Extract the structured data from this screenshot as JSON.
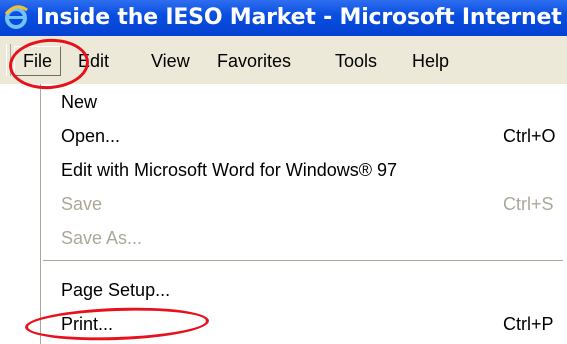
{
  "window": {
    "title": "Inside the IESO Market - Microsoft Internet",
    "app_icon": "internet-explorer-icon"
  },
  "menubar": {
    "items": [
      {
        "label": "File"
      },
      {
        "label": "Edit"
      },
      {
        "label": "View"
      },
      {
        "label": "Favorites"
      },
      {
        "label": "Tools"
      },
      {
        "label": "Help"
      }
    ]
  },
  "file_menu": {
    "items": [
      {
        "label": "New",
        "shortcut": "",
        "enabled": true
      },
      {
        "label": "Open...",
        "shortcut": "Ctrl+O",
        "enabled": true
      },
      {
        "label": "Edit with Microsoft Word for Windows® 97",
        "shortcut": "",
        "enabled": true
      },
      {
        "label": "Save",
        "shortcut": "Ctrl+S",
        "enabled": false
      },
      {
        "label": "Save As...",
        "shortcut": "",
        "enabled": false
      },
      {
        "label": "Page Setup...",
        "shortcut": "",
        "enabled": true
      },
      {
        "label": "Print...",
        "shortcut": "Ctrl+P",
        "enabled": true
      }
    ]
  },
  "colors": {
    "titlebar": "#0a4fe0",
    "menubar": "#ece9d8",
    "disabled_text": "#aca899",
    "annotation": "#e8101a"
  }
}
